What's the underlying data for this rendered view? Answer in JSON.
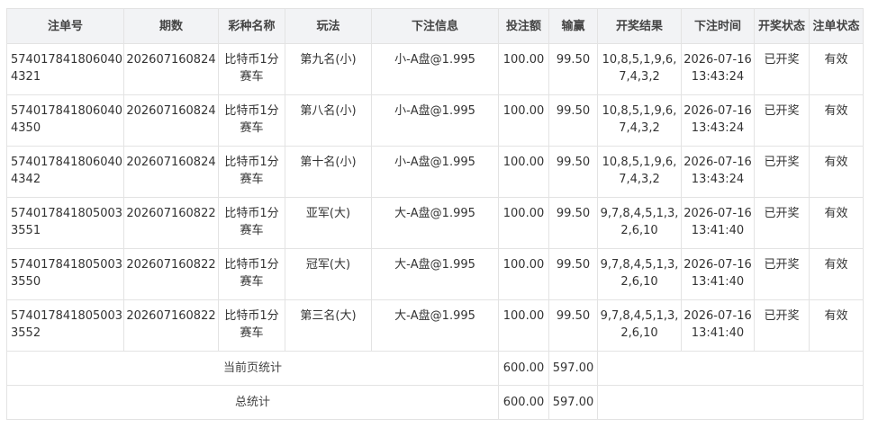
{
  "table": {
    "headers": [
      "注单号",
      "期数",
      "彩种名称",
      "玩法",
      "下注信息",
      "投注额",
      "输赢",
      "开奖结果",
      "下注时间",
      "开奖状态",
      "注单状态"
    ],
    "rows": [
      {
        "order_no": "5740178418060404321",
        "period": "202607160824",
        "game": "比特币1分赛车",
        "play": "第九名(小)",
        "bet_info": "小-A盘@1.995",
        "amount": "100.00",
        "win_loss": "99.50",
        "result": "10,8,5,1,9,6,7,4,3,2",
        "time": "2026-07-16 13:43:24",
        "draw_status": "已开奖",
        "order_status": "有效"
      },
      {
        "order_no": "5740178418060404350",
        "period": "202607160824",
        "game": "比特币1分赛车",
        "play": "第八名(小)",
        "bet_info": "小-A盘@1.995",
        "amount": "100.00",
        "win_loss": "99.50",
        "result": "10,8,5,1,9,6,7,4,3,2",
        "time": "2026-07-16 13:43:24",
        "draw_status": "已开奖",
        "order_status": "有效"
      },
      {
        "order_no": "5740178418060404342",
        "period": "202607160824",
        "game": "比特币1分赛车",
        "play": "第十名(小)",
        "bet_info": "小-A盘@1.995",
        "amount": "100.00",
        "win_loss": "99.50",
        "result": "10,8,5,1,9,6,7,4,3,2",
        "time": "2026-07-16 13:43:24",
        "draw_status": "已开奖",
        "order_status": "有效"
      },
      {
        "order_no": "5740178418050033551",
        "period": "202607160822",
        "game": "比特币1分赛车",
        "play": "亚军(大)",
        "bet_info": "大-A盘@1.995",
        "amount": "100.00",
        "win_loss": "99.50",
        "result": "9,7,8,4,5,1,3,2,6,10",
        "time": "2026-07-16 13:41:40",
        "draw_status": "已开奖",
        "order_status": "有效"
      },
      {
        "order_no": "5740178418050033550",
        "period": "202607160822",
        "game": "比特币1分赛车",
        "play": "冠军(大)",
        "bet_info": "大-A盘@1.995",
        "amount": "100.00",
        "win_loss": "99.50",
        "result": "9,7,8,4,5,1,3,2,6,10",
        "time": "2026-07-16 13:41:40",
        "draw_status": "已开奖",
        "order_status": "有效"
      },
      {
        "order_no": "5740178418050033552",
        "period": "202607160822",
        "game": "比特币1分赛车",
        "play": "第三名(大)",
        "bet_info": "大-A盘@1.995",
        "amount": "100.00",
        "win_loss": "99.50",
        "result": "9,7,8,4,5,1,3,2,6,10",
        "time": "2026-07-16 13:41:40",
        "draw_status": "已开奖",
        "order_status": "有效"
      }
    ],
    "page_total": {
      "label": "当前页统计",
      "amount": "600.00",
      "win_loss": "597.00"
    },
    "grand_total": {
      "label": "总统计",
      "amount": "600.00",
      "win_loss": "597.00"
    }
  },
  "colors": {
    "header_bg": "#f2f3f5",
    "border": "#e3e3e3",
    "text": "#333333"
  }
}
